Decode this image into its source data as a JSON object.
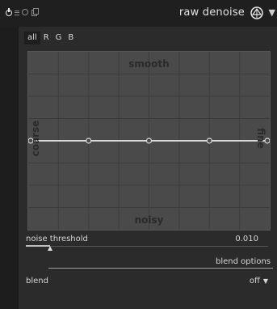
{
  "header": {
    "title": "raw denoise",
    "icons": [
      "power-icon",
      "menu-icon",
      "reset-icon",
      "copy-icon",
      "module-logo-icon",
      "expand-arrow-icon"
    ],
    "expand_glyph": "▼"
  },
  "channels": {
    "tabs": [
      "all",
      "R",
      "G",
      "B"
    ],
    "active": "all"
  },
  "graph": {
    "label_top": "smooth",
    "label_bottom": "noisy",
    "label_left": "coarse",
    "label_right": "fine",
    "curve_level": 0.5,
    "node_count": 5,
    "background": "#4a4a4a",
    "grid_color": "#3c3c3c",
    "curve_color": "#d8d8d8"
  },
  "noise_threshold": {
    "label": "noise threshold",
    "value_text": "0.010",
    "level": 0.1
  },
  "blend_options": {
    "label": "blend options"
  },
  "blend": {
    "label": "blend",
    "value": "off",
    "arrow": "▼"
  }
}
